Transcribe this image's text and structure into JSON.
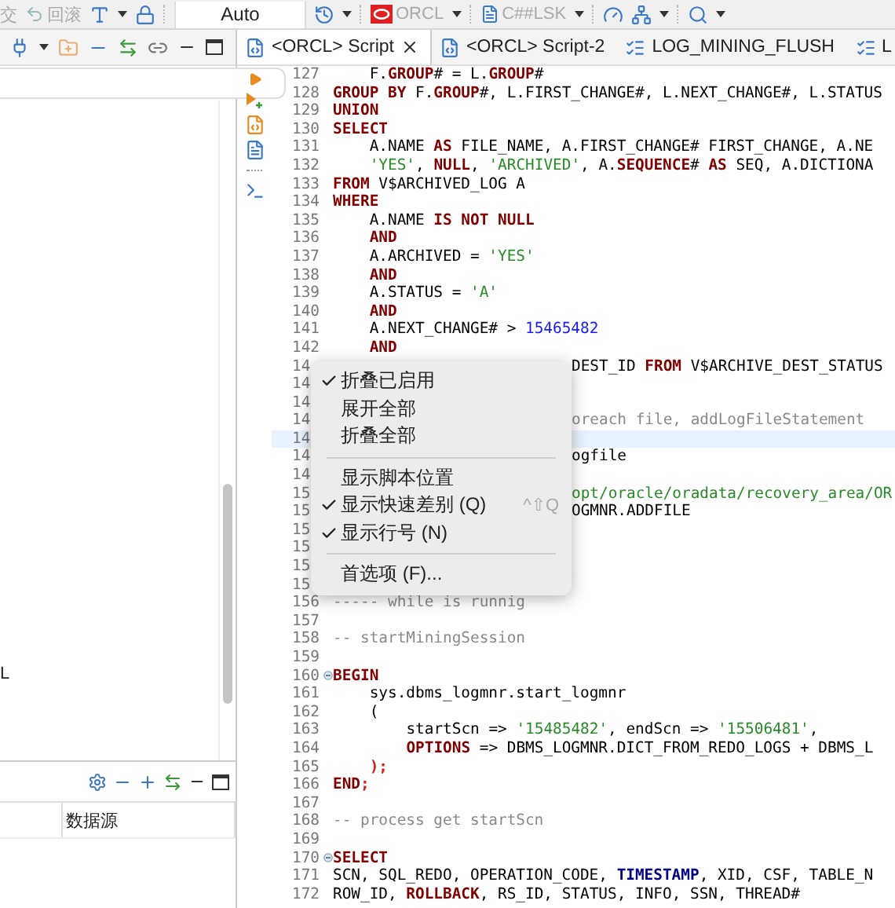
{
  "toolbar": {
    "commit": {
      "label": "交",
      "disabled": true
    },
    "rollback": {
      "label": "回滚",
      "disabled": true
    },
    "mode": "Auto",
    "connection": "ORCL",
    "schema": "C##LSK"
  },
  "left_panel": {
    "tree": [
      {
        "label": "L"
      }
    ],
    "bottom_table": {
      "columns": [
        "数据源"
      ]
    }
  },
  "tabs": [
    {
      "label": "<ORCL> Script",
      "kind": "script",
      "selected": true
    },
    {
      "label": "<ORCL> Script-2",
      "kind": "script",
      "selected": false
    },
    {
      "label": "LOG_MINING_FLUSH",
      "kind": "table",
      "selected": false
    },
    {
      "label": "L",
      "kind": "table",
      "selected": false
    }
  ],
  "editor": {
    "lines": [
      {
        "num": "127",
        "kind": "indented",
        "tokens": [
          {
            "kind": "plain",
            "text": "F."
          },
          {
            "kind": "keyword",
            "text": "GROUP"
          },
          {
            "kind": "plain",
            "text": "# = L."
          },
          {
            "kind": "keyword",
            "text": "GROUP"
          },
          {
            "kind": "plain",
            "text": "#"
          }
        ]
      },
      {
        "num": "128",
        "tokens": [
          {
            "kind": "keyword",
            "text": "GROUP BY"
          },
          {
            "kind": "plain",
            "text": " F."
          },
          {
            "kind": "keyword",
            "text": "GROUP"
          },
          {
            "kind": "plain",
            "text": "#, L.FIRST_CHANGE#, L.NEXT_CHANGE#, L.STATUS"
          }
        ]
      },
      {
        "num": "129",
        "tokens": [
          {
            "kind": "keyword",
            "text": "UNION"
          }
        ]
      },
      {
        "num": "130",
        "tokens": [
          {
            "kind": "keyword",
            "text": "SELECT"
          }
        ]
      },
      {
        "num": "131",
        "kind": "indented",
        "tokens": [
          {
            "kind": "plain",
            "text": "A.NAME "
          },
          {
            "kind": "keyword",
            "text": "AS"
          },
          {
            "kind": "plain",
            "text": " FILE_NAME, A.FIRST_CHANGE# FIRST_CHANGE, A.NE"
          }
        ]
      },
      {
        "num": "132",
        "kind": "indented",
        "tokens": [
          {
            "kind": "string",
            "text": "'YES'"
          },
          {
            "kind": "plain",
            "text": ", "
          },
          {
            "kind": "keyword",
            "text": "NULL"
          },
          {
            "kind": "plain",
            "text": ", "
          },
          {
            "kind": "string",
            "text": "'ARCHIVED'"
          },
          {
            "kind": "plain",
            "text": ", A."
          },
          {
            "kind": "keyword",
            "text": "SEQUENCE"
          },
          {
            "kind": "plain",
            "text": "# "
          },
          {
            "kind": "keyword",
            "text": "AS"
          },
          {
            "kind": "plain",
            "text": " SEQ, A.DICTIONA"
          }
        ]
      },
      {
        "num": "133",
        "tokens": [
          {
            "kind": "keyword",
            "text": "FROM"
          },
          {
            "kind": "plain",
            "text": " V$ARCHIVED_LOG A"
          }
        ]
      },
      {
        "num": "134",
        "tokens": [
          {
            "kind": "keyword",
            "text": "WHERE"
          }
        ]
      },
      {
        "num": "135",
        "kind": "indented",
        "tokens": [
          {
            "kind": "plain",
            "text": "A.NAME "
          },
          {
            "kind": "keyword",
            "text": "IS NOT NULL"
          }
        ]
      },
      {
        "num": "136",
        "kind": "indented",
        "tokens": [
          {
            "kind": "keyword",
            "text": "AND"
          }
        ]
      },
      {
        "num": "137",
        "kind": "indented",
        "tokens": [
          {
            "kind": "plain",
            "text": "A.ARCHIVED = "
          },
          {
            "kind": "string",
            "text": "'YES'"
          }
        ]
      },
      {
        "num": "138",
        "kind": "indented",
        "tokens": [
          {
            "kind": "keyword",
            "text": "AND"
          }
        ]
      },
      {
        "num": "139",
        "kind": "indented",
        "tokens": [
          {
            "kind": "plain",
            "text": "A.STATUS = "
          },
          {
            "kind": "string",
            "text": "'A'"
          }
        ]
      },
      {
        "num": "140",
        "kind": "indented",
        "tokens": [
          {
            "kind": "keyword",
            "text": "AND"
          }
        ]
      },
      {
        "num": "141",
        "kind": "indented",
        "tokens": [
          {
            "kind": "plain",
            "text": "A.NEXT_CHANGE# > "
          },
          {
            "kind": "number",
            "text": "15465482"
          }
        ]
      },
      {
        "num": "142",
        "kind": "indented",
        "tokens": [
          {
            "kind": "keyword",
            "text": "AND"
          }
        ]
      },
      {
        "num": "14",
        "kind": "covered",
        "tokens": [
          {
            "kind": "plain",
            "text": "DEST_ID "
          },
          {
            "kind": "keyword",
            "text": "FROM"
          },
          {
            "kind": "plain",
            "text": " V$ARCHIVE_DEST_STATUS"
          }
        ]
      },
      {
        "num": "14"
      },
      {
        "num": "14"
      },
      {
        "num": "14",
        "kind": "covered",
        "tokens": [
          {
            "kind": "comment",
            "text": "oreach file, addLogFileStatement"
          }
        ]
      },
      {
        "num": "14",
        "current": true
      },
      {
        "num": "14",
        "kind": "covered",
        "tokens": [
          {
            "kind": "plain",
            "text": "ogfile"
          }
        ]
      },
      {
        "num": "14"
      },
      {
        "num": "15",
        "kind": "covered",
        "tokens": [
          {
            "kind": "string",
            "text": "opt/oracle/oradata/recovery_area/OR"
          }
        ]
      },
      {
        "num": "15",
        "kind": "covered",
        "tokens": [
          {
            "kind": "plain",
            "text": "OGMNR.ADDFILE"
          }
        ]
      },
      {
        "num": "15"
      },
      {
        "num": "15"
      },
      {
        "num": "15"
      },
      {
        "num": "15"
      },
      {
        "num": "156",
        "tokens": [
          {
            "kind": "comment",
            "text": "----- while is runnig"
          }
        ]
      },
      {
        "num": "157"
      },
      {
        "num": "158",
        "tokens": [
          {
            "kind": "comment",
            "text": "-- startMiningSession"
          }
        ]
      },
      {
        "num": "159"
      },
      {
        "num": "160",
        "fold": true,
        "tokens": [
          {
            "kind": "keyword",
            "text": "BEGIN"
          }
        ]
      },
      {
        "num": "161",
        "kind": "indented",
        "tokens": [
          {
            "kind": "plain",
            "text": "sys.dbms_logmnr.start_logmnr"
          }
        ]
      },
      {
        "num": "162",
        "kind": "indented",
        "tokens": [
          {
            "kind": "plain",
            "text": "("
          }
        ]
      },
      {
        "num": "163",
        "kind": "nested",
        "tokens": [
          {
            "kind": "plain",
            "text": "startScn => "
          },
          {
            "kind": "string",
            "text": "'15485482'"
          },
          {
            "kind": "plain",
            "text": ", endScn => "
          },
          {
            "kind": "string",
            "text": "'15506481'"
          },
          {
            "kind": "plain",
            "text": ","
          }
        ]
      },
      {
        "num": "164",
        "kind": "nested",
        "tokens": [
          {
            "kind": "keyword",
            "text": "OPTIONS"
          },
          {
            "kind": "plain",
            "text": " => DBMS_LOGMNR.DICT_FROM_REDO_LOGS + DBMS_L"
          }
        ]
      },
      {
        "num": "165",
        "kind": "indented",
        "tokens": [
          {
            "kind": "punct",
            "text": ");"
          }
        ]
      },
      {
        "num": "166",
        "tokens": [
          {
            "kind": "keyword",
            "text": "END"
          },
          {
            "kind": "punct",
            "text": ";"
          }
        ]
      },
      {
        "num": "167"
      },
      {
        "num": "168",
        "tokens": [
          {
            "kind": "comment",
            "text": "-- process get startScn"
          }
        ]
      },
      {
        "num": "169"
      },
      {
        "num": "170",
        "fold": true,
        "tokens": [
          {
            "kind": "keyword",
            "text": "SELECT"
          }
        ]
      },
      {
        "num": "171",
        "tokens": [
          {
            "kind": "plain",
            "text": "SCN, SQL_REDO, OPERATION_CODE, "
          },
          {
            "kind": "type",
            "text": "TIMESTAMP"
          },
          {
            "kind": "plain",
            "text": ", XID, CSF, TABLE_N"
          }
        ]
      },
      {
        "num": "172",
        "tokens": [
          {
            "kind": "plain",
            "text": "ROW_ID, "
          },
          {
            "kind": "keyword",
            "text": "ROLLBACK"
          },
          {
            "kind": "plain",
            "text": ", RS_ID, STATUS, INFO, SSN, THREAD#"
          }
        ]
      }
    ]
  },
  "context_menu": [
    {
      "kind": "item",
      "label": "折叠已启用",
      "checked": true
    },
    {
      "kind": "item",
      "label": "展开全部",
      "checked": false
    },
    {
      "kind": "item",
      "label": "折叠全部",
      "checked": false
    },
    {
      "kind": "separator"
    },
    {
      "kind": "item",
      "label": "显示脚本位置",
      "checked": false
    },
    {
      "kind": "item",
      "label": "显示快速差别 (Q)",
      "checked": true,
      "shortcut": "^⇧Q"
    },
    {
      "kind": "item",
      "label": "显示行号 (N)",
      "checked": true
    },
    {
      "kind": "separator"
    },
    {
      "kind": "item",
      "label": "首选项 (F)...",
      "checked": false
    }
  ]
}
